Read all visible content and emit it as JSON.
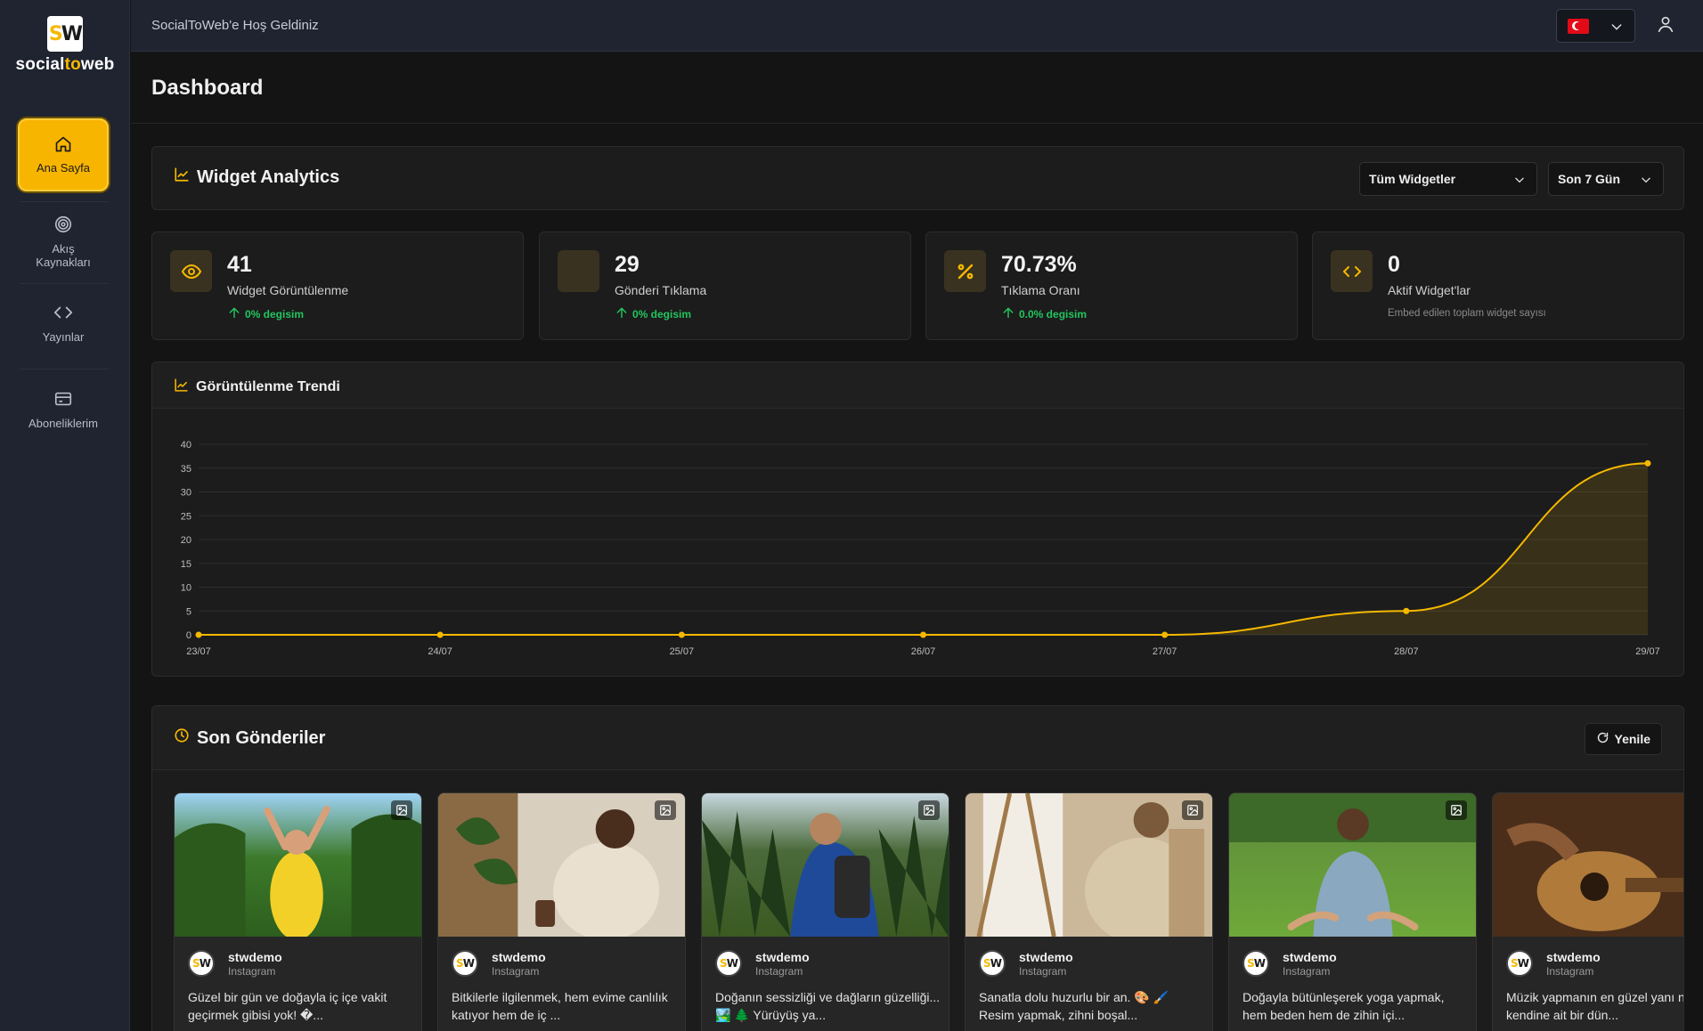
{
  "brand": {
    "logo_mark": "SW",
    "name_part1": "social",
    "name_part2": "to",
    "name_part3": "web"
  },
  "sidebar": {
    "items": [
      {
        "label": "Ana Sayfa",
        "icon": "home-icon",
        "active": true
      },
      {
        "label": "Akış Kaynakları",
        "icon": "target-icon",
        "active": false
      },
      {
        "label": "Yayınlar",
        "icon": "code-icon",
        "active": false
      },
      {
        "label": "Aboneliklerim",
        "icon": "credit-card-icon",
        "active": false
      }
    ]
  },
  "topbar": {
    "welcome": "SocialToWeb'e Hoş Geldiniz",
    "language": "tr",
    "user_icon": "user-icon"
  },
  "page": {
    "title": "Dashboard"
  },
  "analytics": {
    "title": "Widget Analytics",
    "widget_filter": "Tüm Widgetler",
    "period_filter": "Son 7 Gün"
  },
  "stats": [
    {
      "value": "41",
      "label": "Widget Görüntülenme",
      "change": "0% degisim",
      "icon": "eye-icon"
    },
    {
      "value": "29",
      "label": "Gönderi Tıklama",
      "change": "0% degisim",
      "icon": "blank-icon"
    },
    {
      "value": "70.73%",
      "label": "Tıklama Oranı",
      "change": "0.0% degisim",
      "icon": "percent-icon"
    },
    {
      "value": "0",
      "label": "Aktif Widget'lar",
      "note": "Embed edilen toplam widget sayısı",
      "icon": "code-icon"
    }
  ],
  "chart_data": {
    "type": "area",
    "title": "Görüntülenme Trendi",
    "categories": [
      "23/07",
      "24/07",
      "25/07",
      "26/07",
      "27/07",
      "28/07",
      "29/07"
    ],
    "values": [
      0,
      0,
      0,
      0,
      0,
      5,
      36
    ],
    "yticks": [
      0,
      5,
      10,
      15,
      20,
      25,
      30,
      35,
      40
    ],
    "ylim": [
      0,
      40
    ],
    "grid": true,
    "color": "#f5b800"
  },
  "posts": {
    "title": "Son Gönderiler",
    "refresh_label": "Yenile",
    "items": [
      {
        "user": "stwdemo",
        "source": "Instagram",
        "text": "Güzel bir gün ve doğayla iç içe vakit geçirmek gibisi yok! �..."
      },
      {
        "user": "stwdemo",
        "source": "Instagram",
        "text": "Bitkilerle ilgilenmek, hem evime canlılık katıyor hem de iç ..."
      },
      {
        "user": "stwdemo",
        "source": "Instagram",
        "text": "Doğanın sessizliği ve dağların güzelliği... 🏞️ 🌲 Yürüyüş ya..."
      },
      {
        "user": "stwdemo",
        "source": "Instagram",
        "text": "Sanatla dolu huzurlu bir an. 🎨 🖌️ Resim yapmak, zihni boşal..."
      },
      {
        "user": "stwdemo",
        "source": "Instagram",
        "text": "Doğayla bütünleşerek yoga yapmak, hem beden hem de zihin içi..."
      },
      {
        "user": "stwdemo",
        "source": "Instagram",
        "text": "Müzik yapmanın en güzel yanı notada kendine ait bir dün..."
      }
    ]
  },
  "colors": {
    "accent": "#f5b800",
    "positive": "#22c55e",
    "sidebar_bg": "#1f2430",
    "page_bg": "#141414"
  }
}
